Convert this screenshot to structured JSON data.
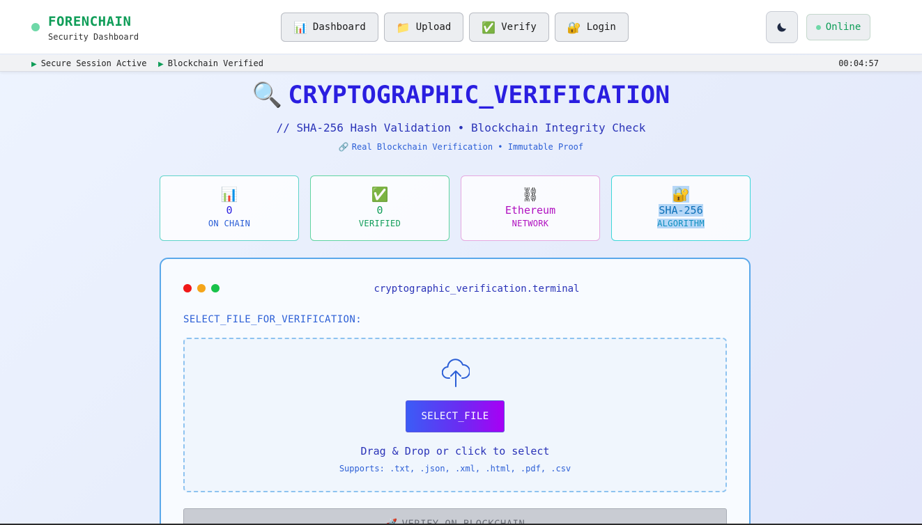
{
  "brand": {
    "name": "FORENCHAIN",
    "subtitle": "Security Dashboard"
  },
  "nav": [
    {
      "icon": "📊",
      "icon_name": "bar-chart-icon",
      "label": "Dashboard"
    },
    {
      "icon": "📁",
      "icon_name": "folder-icon",
      "label": "Upload"
    },
    {
      "icon": "✅",
      "icon_name": "check-box-icon",
      "label": "Verify"
    },
    {
      "icon": "🔐",
      "icon_name": "lock-key-icon",
      "label": "Login"
    }
  ],
  "status": {
    "label": "Online"
  },
  "subbar": {
    "items": [
      "Secure Session Active",
      "Blockchain Verified"
    ],
    "timer": "00:04:57"
  },
  "hero": {
    "icon": "🔍",
    "title": "CRYPTOGRAPHIC_VERIFICATION",
    "subtitle": "// SHA-256 Hash Validation • Blockchain Integrity Check",
    "tagline_icon": "🔗",
    "tagline": "Real Blockchain Verification • Immutable Proof"
  },
  "stats": [
    {
      "icon": "📊",
      "value": "0",
      "label": "ON CHAIN"
    },
    {
      "icon": "✅",
      "value": "0",
      "label": "VERIFIED"
    },
    {
      "icon": "⛓",
      "value": "Ethereum",
      "label": "NETWORK"
    },
    {
      "icon": "🔐",
      "value": "SHA-256",
      "label": "ALGORITHM"
    }
  ],
  "terminal": {
    "title": "cryptographic_verification.terminal",
    "select_label": "SELECT_FILE_FOR_VERIFICATION:",
    "select_button": "SELECT_FILE",
    "drag_text": "Drag & Drop or click to select",
    "supports": "Supports: .txt, .json, .xml, .html, .pdf, .csv",
    "verify_icon": "🚀",
    "verify_button": "VERIFY_ON_BLOCKCHAIN"
  },
  "colors": {
    "accent_green": "#0f9d58",
    "title_blue": "#2a1ee0",
    "traffic_red": "#f01818",
    "traffic_yellow": "#f5a51a",
    "traffic_green": "#18c24a"
  }
}
